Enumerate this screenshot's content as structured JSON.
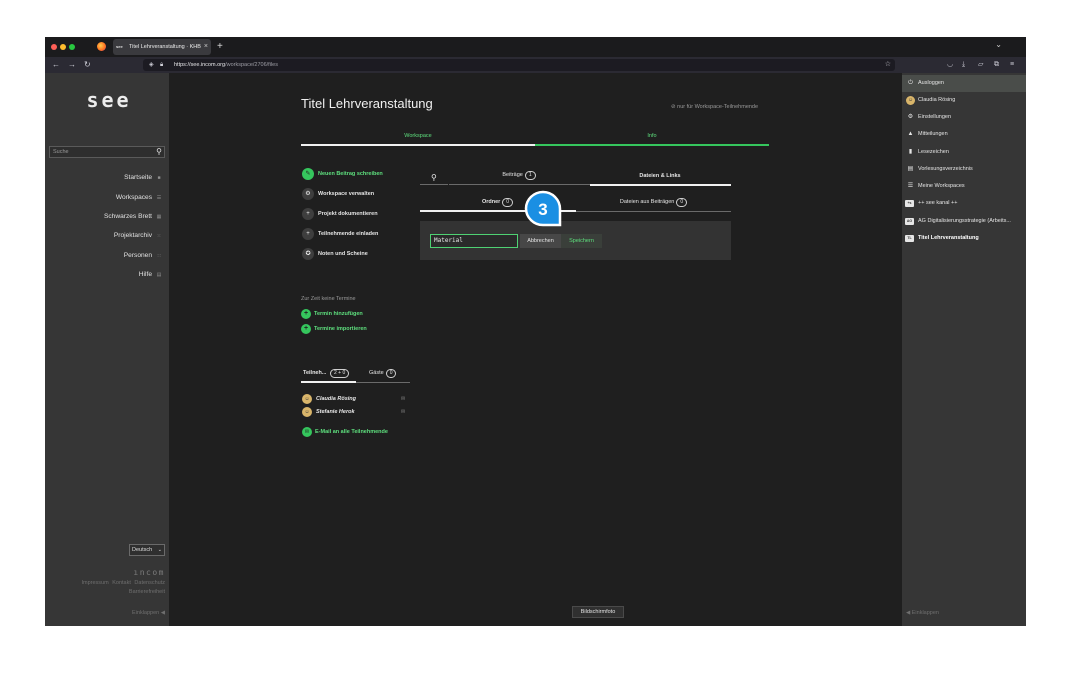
{
  "browser": {
    "tab_title": "Titel Lehrveranstaltung · KHB",
    "tab_favicon": "see",
    "url_domain": "https://see.incom.org",
    "url_path": "/workspace/2706/files"
  },
  "left_sidebar": {
    "logo": "see",
    "search_placeholder": "Suche",
    "nav": [
      {
        "label": "Startseite"
      },
      {
        "label": "Workspaces"
      },
      {
        "label": "Schwarzes Brett"
      },
      {
        "label": "Projektarchiv"
      },
      {
        "label": "Personen"
      },
      {
        "label": "Hilfe"
      }
    ],
    "language": "Deutsch",
    "brand": "ıncom",
    "footer_links": [
      "Impressum",
      "Kontakt",
      "Datenschutz",
      "Barrierefreiheit"
    ],
    "collapse": "Einklappen"
  },
  "right_sidebar": {
    "items": [
      {
        "label": "Ausloggen",
        "icon": "power-icon"
      },
      {
        "label": "Claudia Rösing",
        "icon": "avatar"
      },
      {
        "label": "Einstellungen",
        "icon": "gear-icon"
      },
      {
        "label": "Mitteilungen",
        "icon": "bell-icon"
      },
      {
        "label": "Lesezeichen",
        "icon": "bookmark-icon"
      },
      {
        "label": "Vorlesungsverzeichnis",
        "icon": "book-icon"
      },
      {
        "label": "Meine Workspaces",
        "icon": "list-icon"
      },
      {
        "label": "++ see kanal ++",
        "icon": "workspace-badge",
        "badge": "+s"
      },
      {
        "label": "AG Digitalisierungsstrategie (Arbeits...",
        "icon": "workspace-badge",
        "badge": "AG"
      },
      {
        "label": "Titel Lehrveranstaltung",
        "icon": "workspace-badge",
        "badge": "TL"
      }
    ],
    "collapse": "Einklappen"
  },
  "main": {
    "title": "Titel Lehrveranstaltung",
    "restriction": "nur für Workspace-Teilnehmende",
    "tabs": [
      {
        "label": "Workspace"
      },
      {
        "label": "Info"
      }
    ],
    "actions": [
      {
        "label": "Neuen Beitrag schreiben",
        "icon": "pencil-icon"
      },
      {
        "label": "Workspace verwalten",
        "icon": "gear-icon"
      },
      {
        "label": "Projekt dokumentieren",
        "icon": "plus-icon"
      },
      {
        "label": "Teilnehmende einladen",
        "icon": "plus-icon"
      },
      {
        "label": "Noten und Scheine",
        "icon": "award-icon"
      }
    ],
    "appointments": {
      "empty": "Zur Zeit keine Termine",
      "add": "Termin hinzufügen",
      "import": "Termine importieren"
    },
    "participants": {
      "tab_members": "Teilneh...",
      "tab_members_count": "2 + 0",
      "tab_guests": "Gäste",
      "tab_guests_count": "0",
      "people": [
        "Claudia Rösing",
        "Stefanie Herok"
      ],
      "email_all": "E-Mail an alle Teilnehmende"
    },
    "files": {
      "tab_posts": "Beiträge",
      "tab_posts_count": "1",
      "tab_files": "Dateien & Links",
      "sub_folders": "Ordner",
      "sub_folders_count": "0",
      "sub_from_posts": "Dateien aus Beiträgen",
      "sub_from_posts_count": "0",
      "folder_input_value": "Material",
      "cancel": "Abbrechen",
      "save": "Speichern"
    },
    "step_marker": "3",
    "tooltip": "Bildschirmfoto"
  },
  "colors": {
    "accent_green": "#35c65d",
    "text_green": "#5ee07e",
    "sidebar_bg": "#363636",
    "content_bg": "#1f1f1f",
    "marker_blue": "#1a8fe3"
  }
}
